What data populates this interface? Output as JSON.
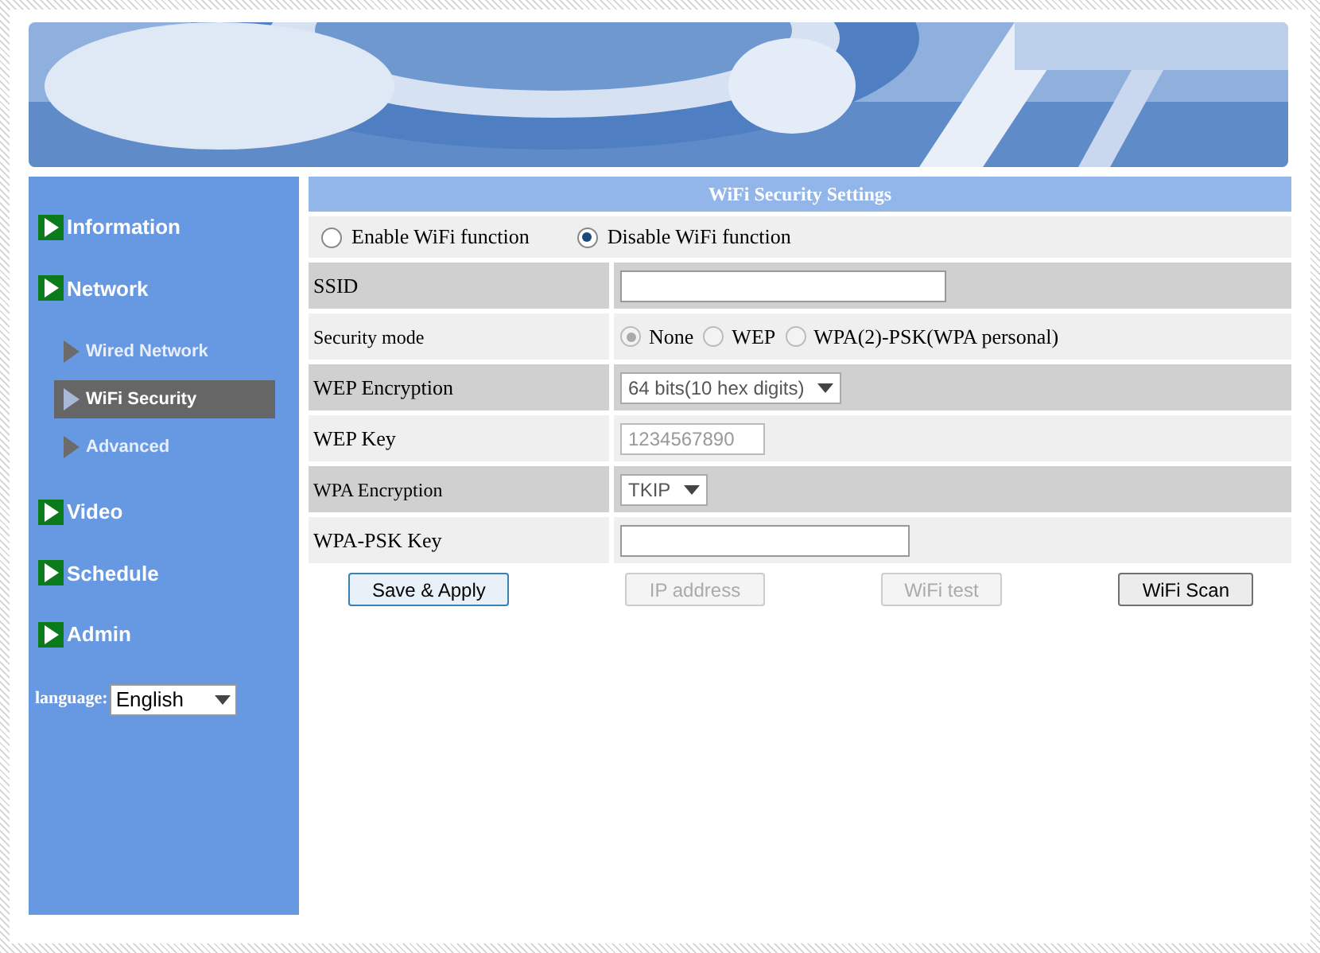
{
  "sidebar": {
    "items": [
      {
        "label": "Information"
      },
      {
        "label": "Network",
        "children": [
          {
            "label": "Wired Network",
            "selected": false
          },
          {
            "label": "WiFi Security",
            "selected": true
          },
          {
            "label": "Advanced",
            "selected": false
          }
        ]
      },
      {
        "label": "Video"
      },
      {
        "label": "Schedule"
      },
      {
        "label": "Admin"
      }
    ],
    "language": {
      "label": "language:",
      "value": "English"
    }
  },
  "panel": {
    "title": "WiFi Security Settings",
    "wifi_function": [
      {
        "label": "Enable WiFi function",
        "selected": false
      },
      {
        "label": "Disable WiFi function",
        "selected": true
      }
    ],
    "rows": [
      {
        "kind": "text",
        "label": "SSID",
        "value": "",
        "disabled": false
      },
      {
        "kind": "radio",
        "label": "Security mode",
        "disabled": true,
        "options": [
          {
            "label": "None",
            "selected": true
          },
          {
            "label": "WEP",
            "selected": false
          },
          {
            "label": "WPA(2)-PSK(WPA personal)",
            "selected": false
          }
        ]
      },
      {
        "kind": "select",
        "label": "WEP Encryption",
        "value": "64 bits(10 hex digits)"
      },
      {
        "kind": "text",
        "label": "WEP Key",
        "value": "1234567890",
        "disabled": true
      },
      {
        "kind": "select",
        "label": "WPA Encryption",
        "value": "TKIP"
      },
      {
        "kind": "text",
        "label": "WPA-PSK Key",
        "value": "",
        "disabled": false
      }
    ],
    "buttons": [
      {
        "label": "Save & Apply",
        "disabled": false
      },
      {
        "label": "IP address",
        "disabled": true
      },
      {
        "label": "WiFi test",
        "disabled": true
      },
      {
        "label": "WiFi Scan",
        "disabled": false
      }
    ]
  }
}
